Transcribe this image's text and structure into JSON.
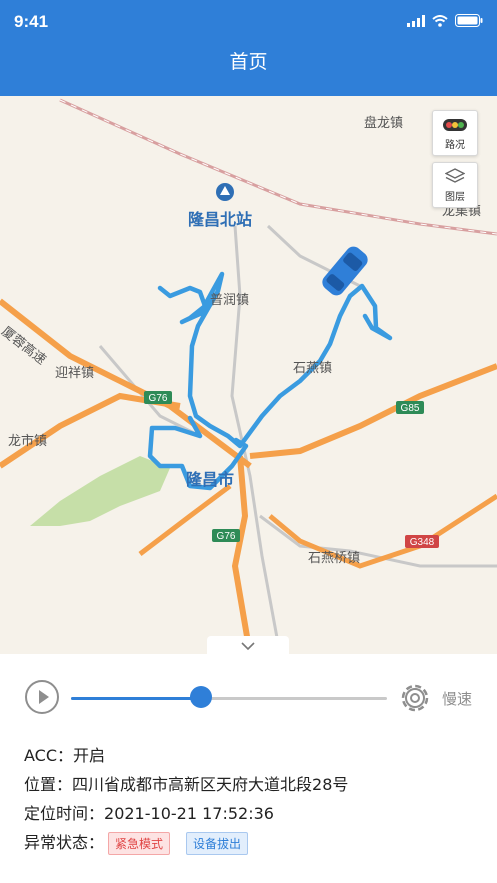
{
  "status_bar": {
    "time": "9:41"
  },
  "header": {
    "title": "首页"
  },
  "map": {
    "labels": {
      "panlong": "盘龙镇",
      "longchang_north_station": "隆昌北站",
      "longji": "龙集镇",
      "purun": "普润镇",
      "yingxiang": "迎祥镇",
      "shiyan": "石燕镇",
      "longshi": "龙市镇",
      "longchang_city": "隆昌市",
      "shiyanqiao": "石燕桥镇",
      "expressway": "厦蓉高速"
    },
    "road_shields": {
      "g76_top": "G76",
      "g85": "G85",
      "g76_bottom": "G76",
      "g348": "G348"
    },
    "buttons": {
      "traffic": "路况",
      "layers": "图层"
    },
    "colors": {
      "route": "#3a9be0",
      "highway": "#f5a04a",
      "vehicle": "#2f7fd8"
    }
  },
  "playback": {
    "progress": 0.41,
    "speed_label": "慢速"
  },
  "info": {
    "acc_label": "ACC：",
    "acc_value": "开启",
    "location_label": "位置：",
    "location_value": "四川省成都市高新区天府大道北段28号",
    "time_label": "定位时间：",
    "time_value": "2021-10-21 17:52:36",
    "abnormal_label": "异常状态：",
    "tags": {
      "emergency": "紧急模式",
      "unplugged": "设备拔出"
    }
  }
}
